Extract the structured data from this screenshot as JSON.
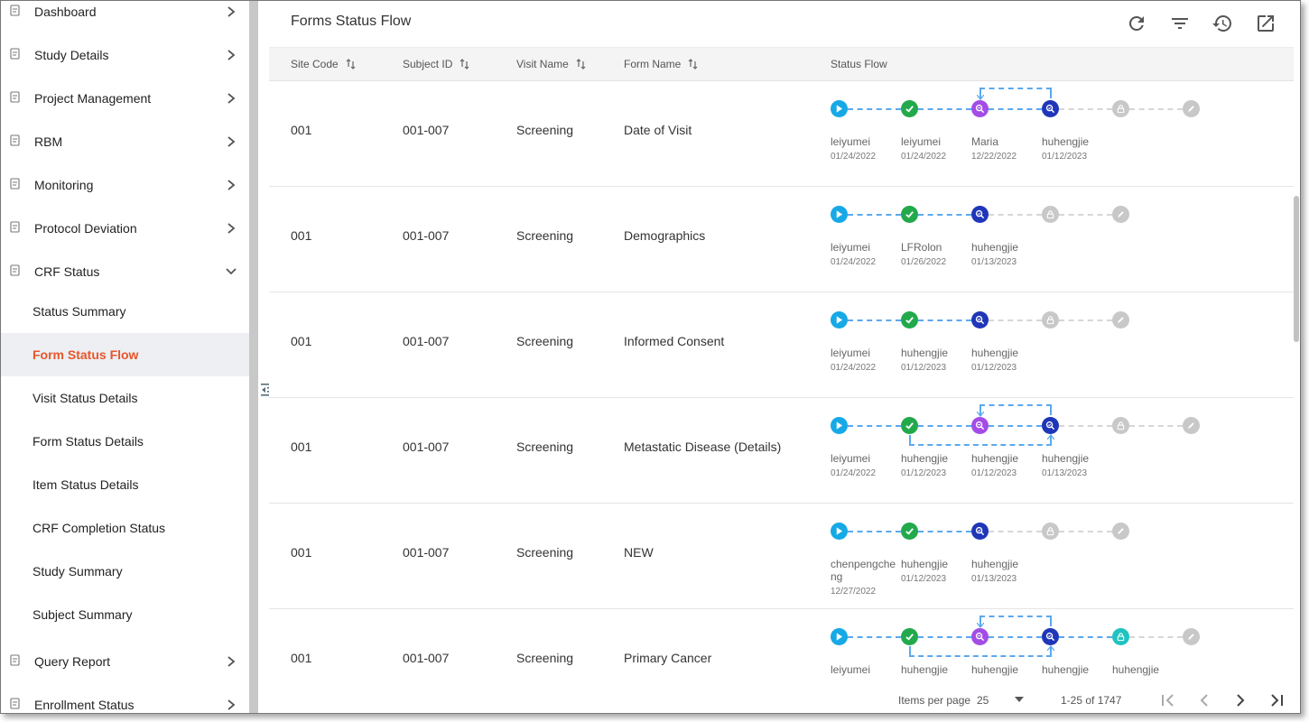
{
  "sidebar": {
    "items": [
      {
        "label": "Dashboard",
        "icon": "dashboard-icon",
        "chevron": "right"
      },
      {
        "label": "Study Details",
        "icon": "study-icon",
        "chevron": "right"
      },
      {
        "label": "Project Management",
        "icon": "project-icon",
        "chevron": "right"
      },
      {
        "label": "RBM",
        "icon": "rbm-icon",
        "chevron": "right"
      },
      {
        "label": "Monitoring",
        "icon": "monitoring-icon",
        "chevron": "right"
      },
      {
        "label": "Protocol Deviation",
        "icon": "document-icon",
        "chevron": "right"
      },
      {
        "label": "CRF Status",
        "icon": "crf-icon",
        "chevron": "down"
      }
    ],
    "subitems": [
      {
        "label": "Status Summary",
        "active": false
      },
      {
        "label": "Form Status Flow",
        "active": true
      },
      {
        "label": "Visit Status Details",
        "active": false
      },
      {
        "label": "Form Status Details",
        "active": false
      },
      {
        "label": "Item Status Details",
        "active": false
      },
      {
        "label": "CRF Completion Status",
        "active": false
      },
      {
        "label": "Study Summary",
        "active": false
      },
      {
        "label": "Subject Summary",
        "active": false
      }
    ],
    "bottom_items": [
      {
        "label": "Query Report",
        "icon": "query-icon",
        "chevron": "right"
      },
      {
        "label": "Enrollment Status",
        "icon": "grid-icon",
        "chevron": "right"
      }
    ],
    "active_color": "#e8552a"
  },
  "main": {
    "title": "Forms Status Flow",
    "toolbar": [
      "refresh-icon",
      "filter-icon",
      "history-icon",
      "open-external-icon"
    ],
    "columns": {
      "site_code": "Site Code",
      "subject_id": "Subject ID",
      "visit_name": "Visit Name",
      "form_name": "Form Name",
      "status_flow": "Status Flow"
    },
    "rows": [
      {
        "site": "001",
        "subject": "001-007",
        "visit": "Screening",
        "form": "Date of Visit",
        "loop": "top",
        "nodes": [
          {
            "type": "start",
            "user": "leiyumei",
            "date": "01/24/2022"
          },
          {
            "type": "done",
            "user": "leiyumei",
            "date": "01/24/2022"
          },
          {
            "type": "query",
            "user": "Maria",
            "date": "12/22/2022"
          },
          {
            "type": "review",
            "user": "huhengjie",
            "date": "01/12/2023"
          },
          {
            "type": "lock-gray",
            "user": "",
            "date": ""
          },
          {
            "type": "sign-gray",
            "user": "",
            "date": ""
          }
        ]
      },
      {
        "site": "001",
        "subject": "001-007",
        "visit": "Screening",
        "form": "Demographics",
        "loop": "none",
        "nodes": [
          {
            "type": "start",
            "user": "leiyumei",
            "date": "01/24/2022"
          },
          {
            "type": "done",
            "user": "LFRolon",
            "date": "01/26/2022"
          },
          {
            "type": "review",
            "user": "huhengjie",
            "date": "01/13/2023"
          },
          {
            "type": "lock-gray",
            "user": "",
            "date": ""
          },
          {
            "type": "sign-gray",
            "user": "",
            "date": ""
          }
        ]
      },
      {
        "site": "001",
        "subject": "001-007",
        "visit": "Screening",
        "form": "Informed Consent",
        "loop": "none",
        "nodes": [
          {
            "type": "start",
            "user": "leiyumei",
            "date": "01/24/2022"
          },
          {
            "type": "done",
            "user": "huhengjie",
            "date": "01/12/2023"
          },
          {
            "type": "review",
            "user": "huhengjie",
            "date": "01/12/2023"
          },
          {
            "type": "lock-gray",
            "user": "",
            "date": ""
          },
          {
            "type": "sign-gray",
            "user": "",
            "date": ""
          }
        ]
      },
      {
        "site": "001",
        "subject": "001-007",
        "visit": "Screening",
        "form": "Metastatic Disease (Details)",
        "loop": "both",
        "nodes": [
          {
            "type": "start",
            "user": "leiyumei",
            "date": "01/24/2022"
          },
          {
            "type": "done",
            "user": "huhengjie",
            "date": "01/12/2023"
          },
          {
            "type": "query",
            "user": "huhengjie",
            "date": "01/12/2023"
          },
          {
            "type": "review",
            "user": "huhengjie",
            "date": "01/13/2023"
          },
          {
            "type": "lock-gray",
            "user": "",
            "date": ""
          },
          {
            "type": "sign-gray",
            "user": "",
            "date": ""
          }
        ]
      },
      {
        "site": "001",
        "subject": "001-007",
        "visit": "Screening",
        "form": "NEW",
        "loop": "none",
        "nodes": [
          {
            "type": "start",
            "user": "chenpengche\nng",
            "date": "12/27/2022"
          },
          {
            "type": "done",
            "user": "huhengjie",
            "date": "01/12/2023"
          },
          {
            "type": "review",
            "user": "huhengjie",
            "date": "01/13/2023"
          },
          {
            "type": "lock-gray",
            "user": "",
            "date": ""
          },
          {
            "type": "sign-gray",
            "user": "",
            "date": ""
          }
        ]
      },
      {
        "site": "001",
        "subject": "001-007",
        "visit": "Screening",
        "form": "Primary Cancer",
        "loop": "both",
        "nodes": [
          {
            "type": "start",
            "user": "leiyumei",
            "date": ""
          },
          {
            "type": "done",
            "user": "huhengjie",
            "date": ""
          },
          {
            "type": "query",
            "user": "huhengjie",
            "date": ""
          },
          {
            "type": "review",
            "user": "huhengjie",
            "date": ""
          },
          {
            "type": "lock-teal",
            "user": "huhengjie",
            "date": ""
          },
          {
            "type": "sign-gray",
            "user": "",
            "date": ""
          }
        ]
      }
    ],
    "node_colors": {
      "start": "#16a9e6",
      "done": "#22a94b",
      "query": "#a34ce6",
      "review": "#1f36b8",
      "lock-gray": "#c8c8c8",
      "sign-gray": "#c8c8c8",
      "lock-teal": "#1fc3c0"
    }
  },
  "pager": {
    "items_per_page_label": "Items per page",
    "items_per_page": "25",
    "range": "1-25 of 1747"
  }
}
